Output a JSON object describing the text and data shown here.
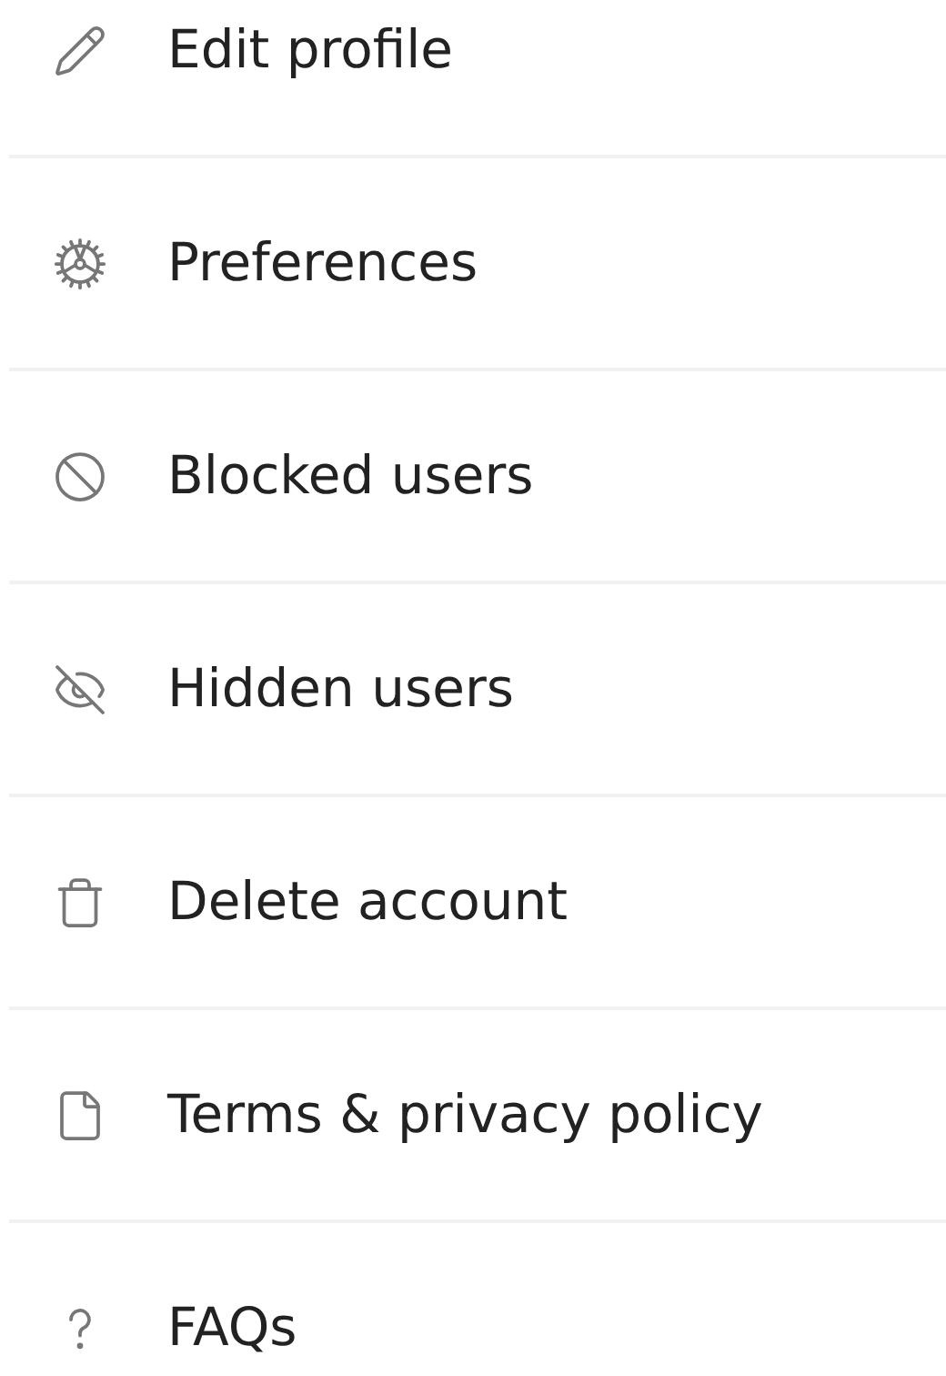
{
  "menu": [
    {
      "kind": "pencil",
      "label": "Edit profile"
    },
    {
      "kind": "gear",
      "label": "Preferences"
    },
    {
      "kind": "ban",
      "label": "Blocked users"
    },
    {
      "kind": "eye-off",
      "label": "Hidden users"
    },
    {
      "kind": "trash",
      "label": "Delete account"
    },
    {
      "kind": "file",
      "label": "Terms & privacy policy"
    },
    {
      "kind": "question",
      "label": "FAQs"
    }
  ]
}
